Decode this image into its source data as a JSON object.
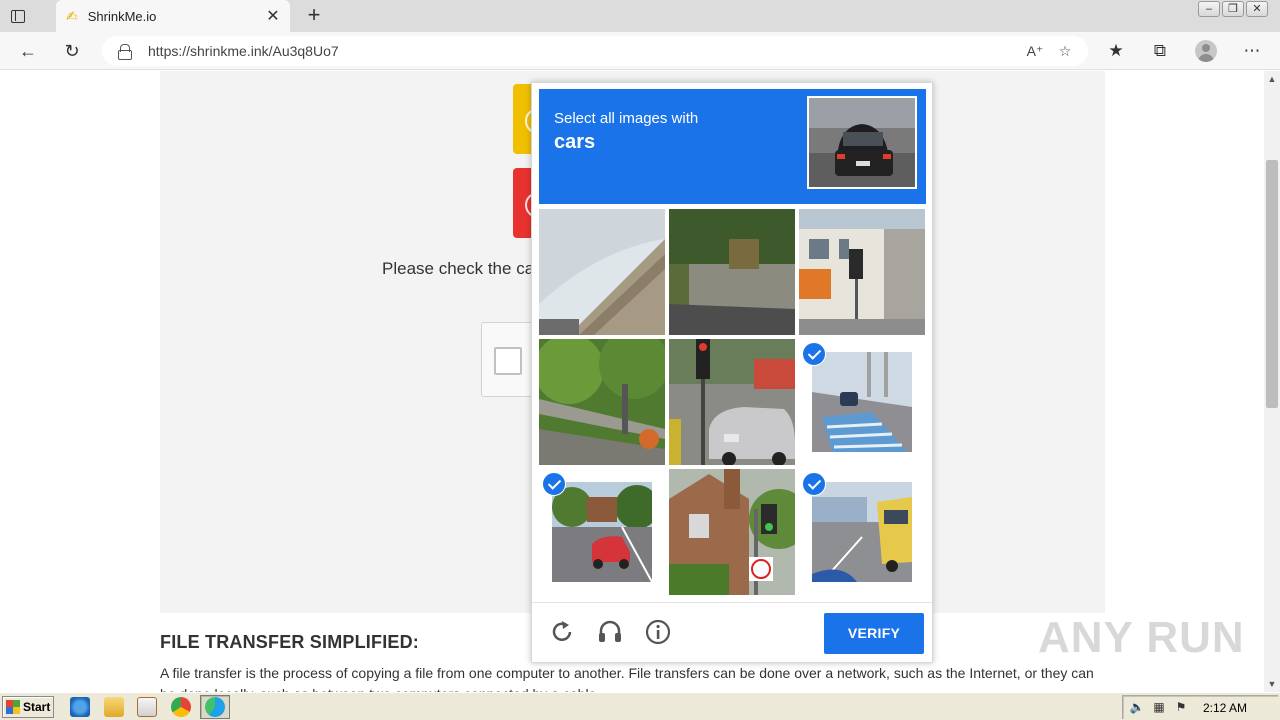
{
  "browser": {
    "tab_title": "ShrinkMe.io",
    "url": "https://shrinkme.ink/Au3q8Uo7",
    "read_aloud_icon": "read-aloud-icon",
    "favorite_icon": "add-favorite-icon"
  },
  "page": {
    "check_text": "Please check the ca",
    "section_title": "FILE TRANSFER SIMPLIFIED:",
    "section_text": "A file transfer is the process of copying a file from one computer to another. File transfers can be done over a network, such as the Internet, or they can be done locally, such as between two computers connected by a cable."
  },
  "captcha": {
    "instruction": "Select all images with",
    "target": "cars",
    "verify_label": "VERIFY",
    "tiles": [
      {
        "subject": "highway-wall",
        "selected": false
      },
      {
        "subject": "stone-wall-street",
        "selected": false
      },
      {
        "subject": "storefront-traffic-light",
        "selected": false
      },
      {
        "subject": "roadside-trees",
        "selected": false
      },
      {
        "subject": "traffic-light-car",
        "selected": false
      },
      {
        "subject": "bridge-crosswalk-car",
        "selected": true
      },
      {
        "subject": "red-car-road",
        "selected": true
      },
      {
        "subject": "house-traffic-light",
        "selected": false
      },
      {
        "subject": "bus-road",
        "selected": true
      }
    ],
    "accent_color": "#1a73e8"
  },
  "watermark": {
    "text": "ANY RUN"
  },
  "taskbar": {
    "start_label": "Start",
    "clock": "2:12 AM"
  }
}
